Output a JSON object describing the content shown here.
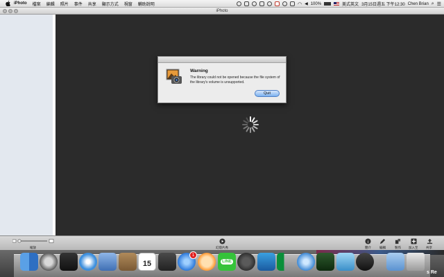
{
  "menubar": {
    "app": "iPhoto",
    "items": [
      "檔案",
      "編輯",
      "照片",
      "事件",
      "共享",
      "顯示方式",
      "視窗",
      "輔助說明"
    ],
    "battery": "100%",
    "input_method": "美式英文",
    "datetime": "3月15日週五 下午12:30",
    "user": "Chen Brian"
  },
  "window": {
    "title": "iPhoto"
  },
  "dialog": {
    "heading": "Warning",
    "message": "The library could not be opened because the file system of the library's volume is unsupported.",
    "quit_label": "Quit"
  },
  "toolbar": {
    "zoom_label": "縮放",
    "slideshow_label": "幻燈片秀",
    "info_label": "簡介",
    "edit_label": "編輯",
    "create_label": "製作",
    "add_label": "加入至",
    "share_label": "共享"
  },
  "dock": {
    "calendar_day": "15",
    "appstore_badge": "1",
    "line_label": "LINE",
    "edge_text": "s Re"
  },
  "colors": {
    "main_bg": "#2b2b2b",
    "sidebar_bg": "#e3e8ef",
    "quit_button": "#7cb1ef"
  }
}
